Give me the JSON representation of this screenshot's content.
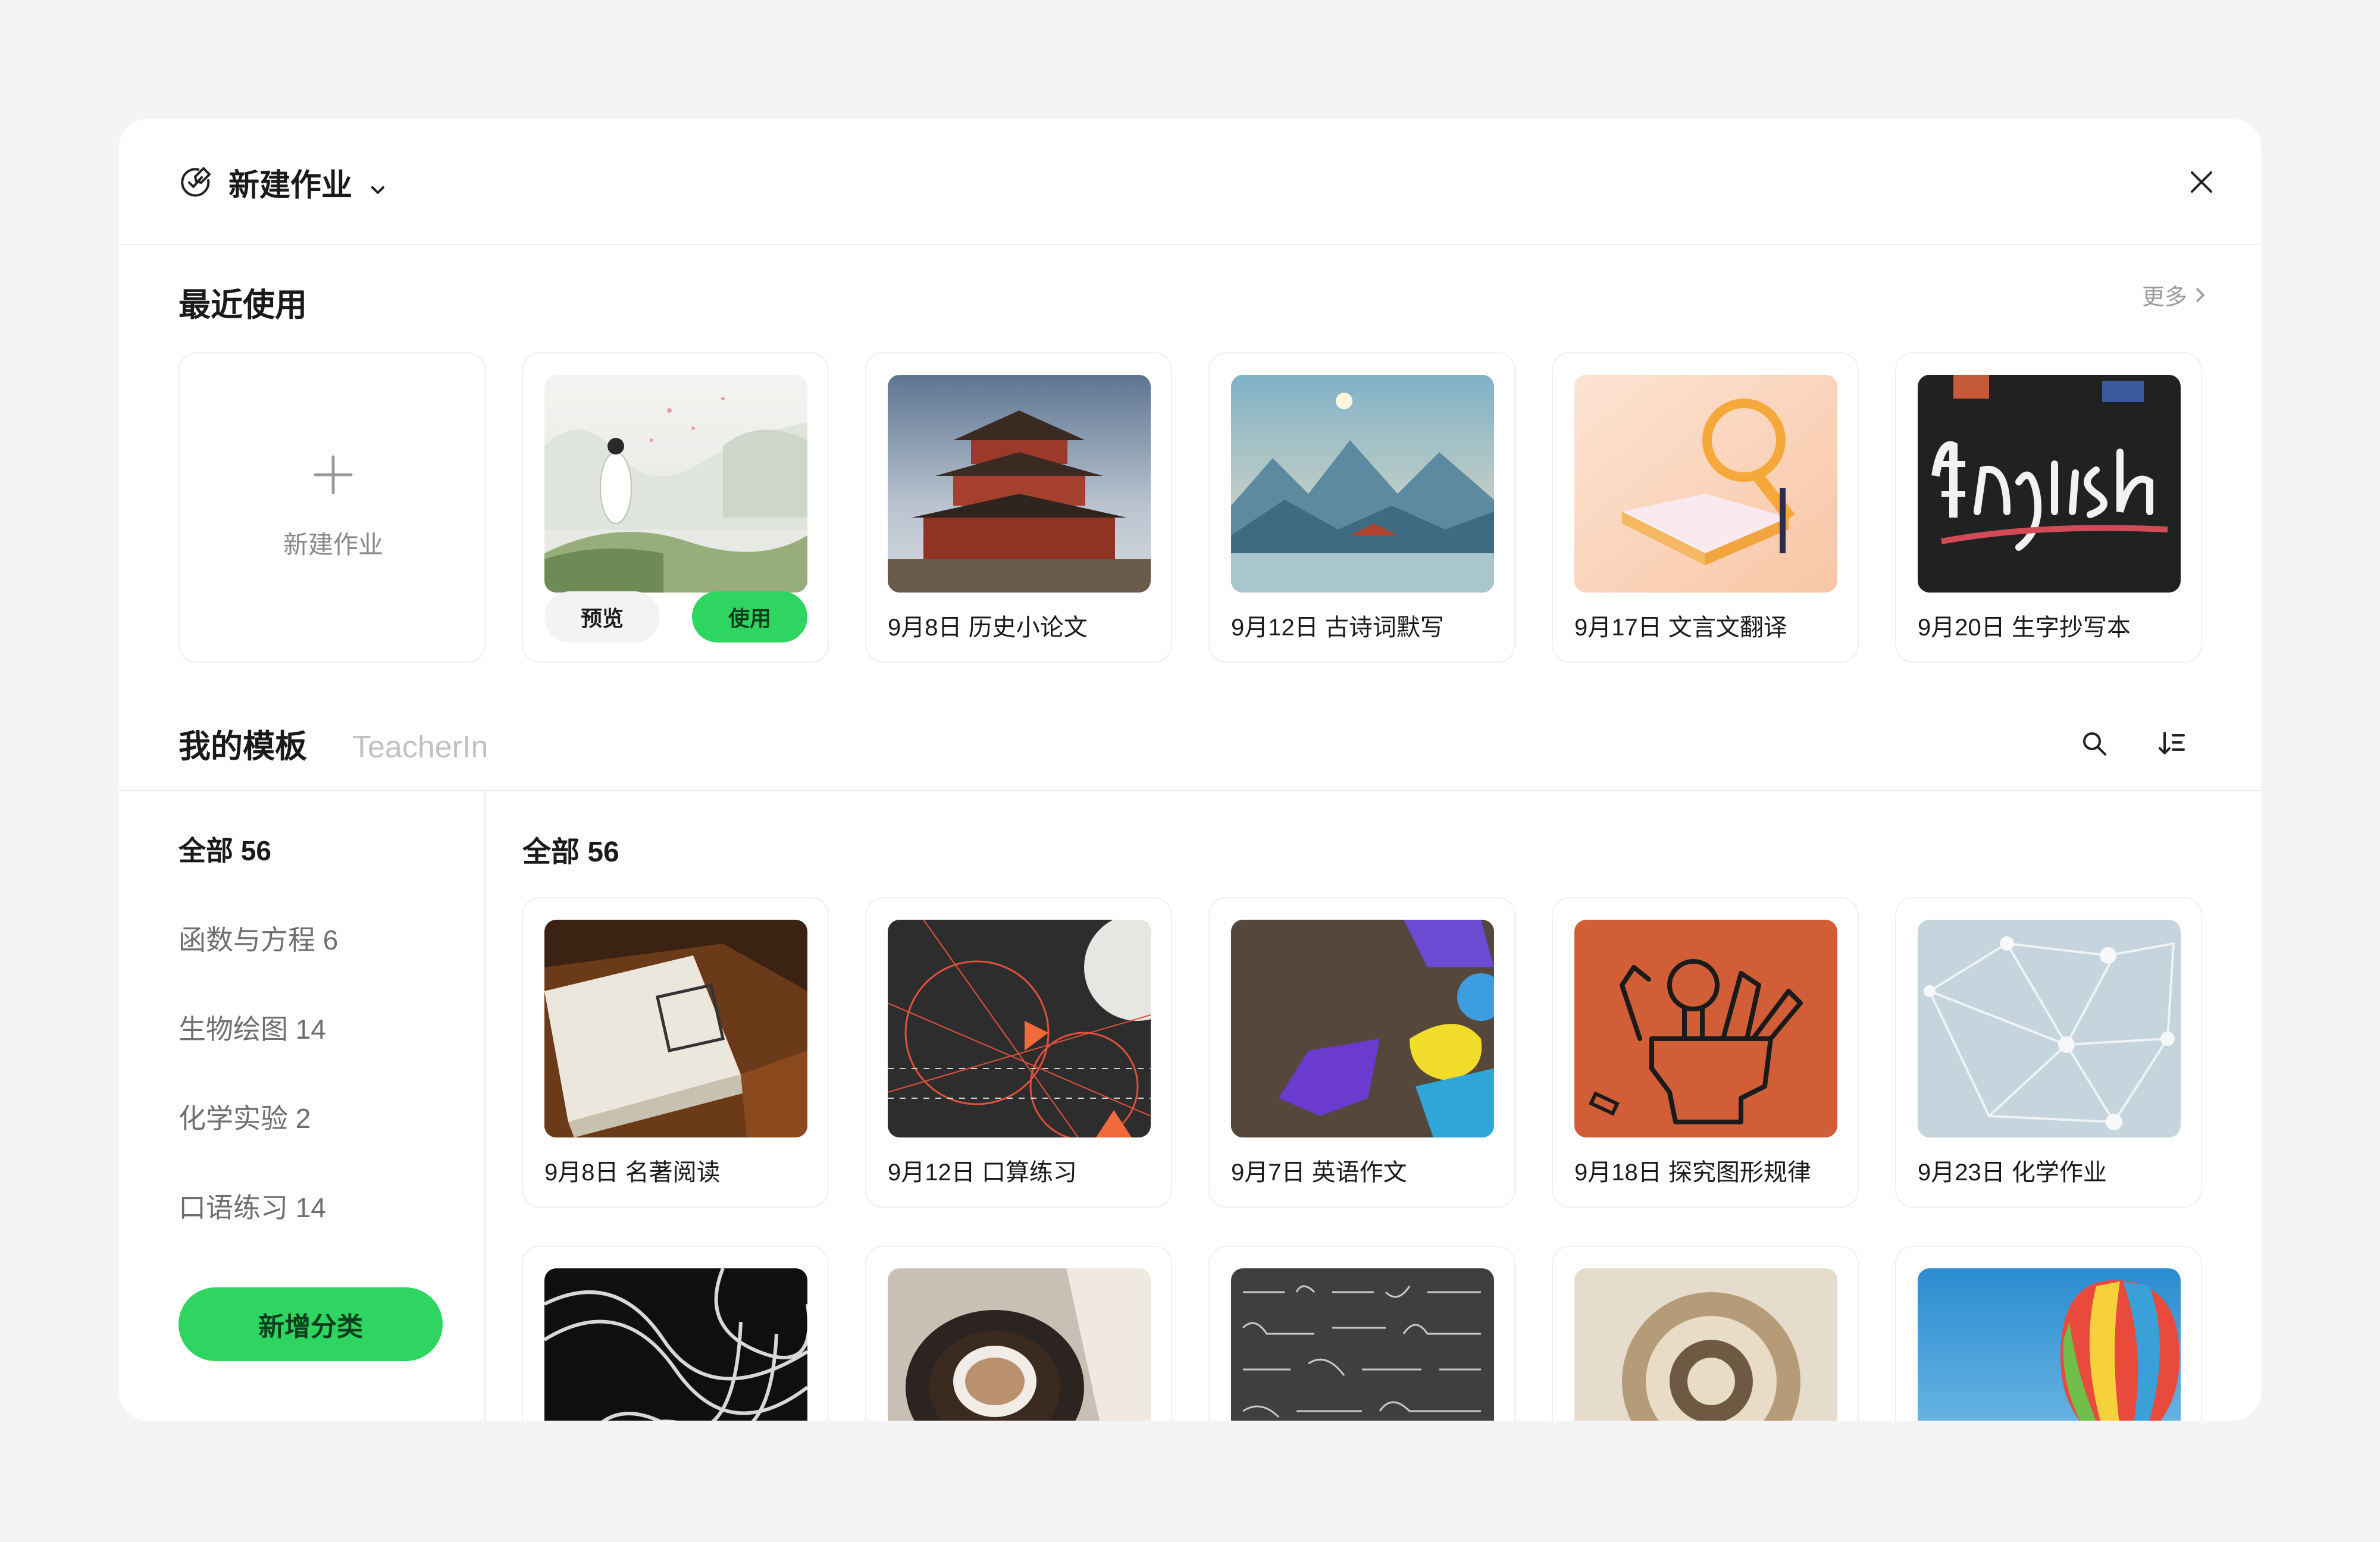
{
  "header": {
    "title": "新建作业",
    "title_icon": "assignment-icon",
    "dropdown_icon": "chevron-down-icon",
    "close_icon": "close-icon"
  },
  "recent": {
    "title": "最近使用",
    "more": "更多",
    "new_card_label": "新建作业",
    "hover_card": {
      "preview_label": "预览",
      "use_label": "使用"
    },
    "items": [
      {
        "caption": "9月8日 历史小论文"
      },
      {
        "caption": "9月12日 古诗词默写"
      },
      {
        "caption": "9月17日 文言文翻译"
      },
      {
        "caption": "9月20日 生字抄写本"
      }
    ]
  },
  "templates": {
    "tab_active": "我的模板",
    "tab_inactive": "TeacherIn",
    "search_icon": "search-icon",
    "sort_icon": "sort-icon",
    "categories": [
      {
        "label": "全部 56"
      },
      {
        "label": "函数与方程 6"
      },
      {
        "label": "生物绘图 14"
      },
      {
        "label": "化学实验 2"
      },
      {
        "label": "口语练习 14"
      }
    ],
    "add_category": "新增分类",
    "grid_title": "全部 56",
    "items": [
      {
        "caption": "9月8日 名著阅读"
      },
      {
        "caption": "9月12日 口算练习"
      },
      {
        "caption": "9月7日 英语作文"
      },
      {
        "caption": "9月18日 探究图形规律"
      },
      {
        "caption": "9月23日 化学作业"
      }
    ]
  },
  "colors": {
    "accent_green": "#2ed661",
    "background": "#f4f4f6",
    "card_border": "#f0f0f0"
  }
}
